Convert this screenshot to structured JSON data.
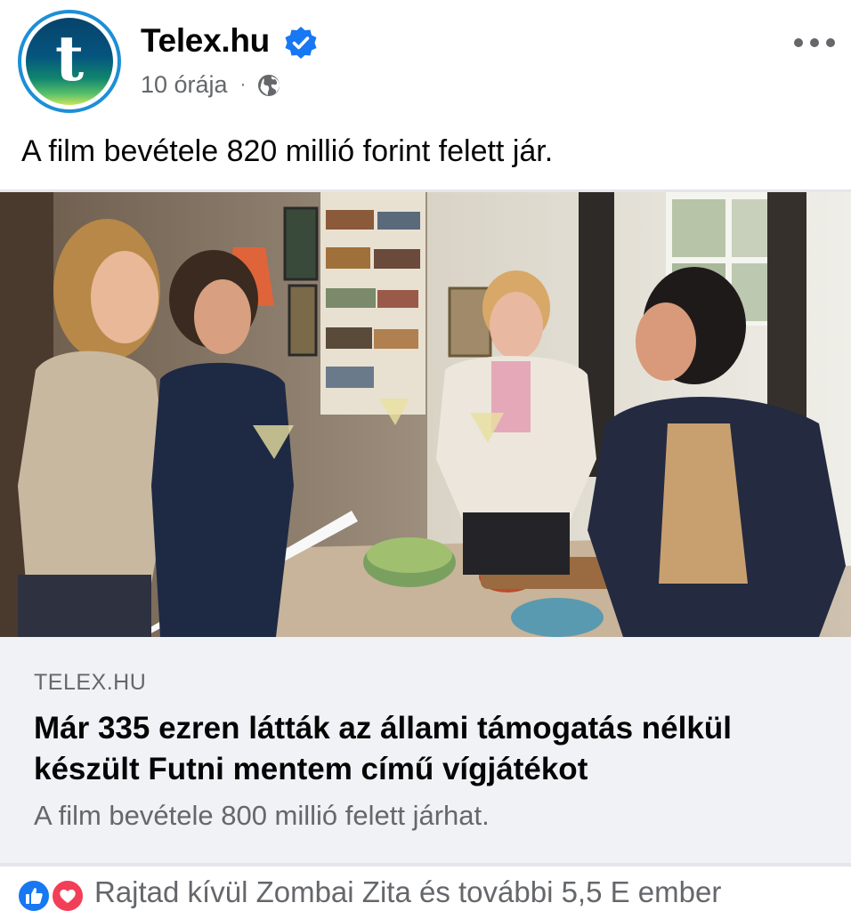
{
  "post": {
    "page_name": "Telex.hu",
    "time": "10 órája",
    "separator": "·",
    "avatar_letter": "t",
    "text": "A film bevétele 820 millió forint felett jár."
  },
  "link_card": {
    "domain": "TELEX.HU",
    "title": "Már 335 ezren látták az állami támogatás nélkül készült Futni mentem című vígjátékot",
    "description": "A film bevétele 800 millió felett járhat."
  },
  "reactions": {
    "summary": "Rajtad kívül Zombai Zita és további 5,5 E ember",
    "icons": [
      "like-icon",
      "love-icon"
    ]
  },
  "icons": {
    "verified": "verified-badge-icon",
    "audience": "globe-icon",
    "menu": "more-options-icon"
  },
  "colors": {
    "brand_blue": "#1877f2",
    "love_red": "#f33e58",
    "secondary_text": "#65676b",
    "card_bg": "#f0f2f5"
  }
}
